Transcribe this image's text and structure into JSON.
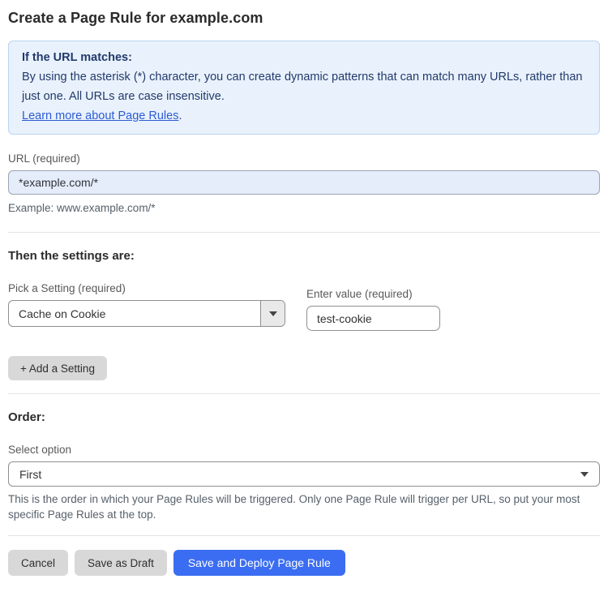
{
  "page": {
    "title": "Create a Page Rule for example.com"
  },
  "info_box": {
    "heading": "If the URL matches:",
    "body": "By using the asterisk (*) character, you can create dynamic patterns that can match many URLs, rather than just one. All URLs are case insensitive.",
    "link_label": "Learn more about Page Rules",
    "link_suffix": "."
  },
  "url_field": {
    "label": "URL (required)",
    "value": "*example.com/*",
    "example": "Example: www.example.com/*"
  },
  "settings_section": {
    "heading": "Then the settings are:",
    "setting_select": {
      "label": "Pick a Setting (required)",
      "value": "Cache on Cookie"
    },
    "value_field": {
      "label": "Enter value (required)",
      "value": "test-cookie"
    },
    "add_button_label": "+ Add a Setting"
  },
  "order_section": {
    "heading": "Order:",
    "select_label": "Select option",
    "select_value": "First",
    "help_text": "This is the order in which your Page Rules will be triggered. Only one Page Rule will trigger per URL, so put your most specific Page Rules at the top."
  },
  "footer": {
    "cancel_label": "Cancel",
    "save_draft_label": "Save as Draft",
    "save_deploy_label": "Save and Deploy Page Rule"
  },
  "colors": {
    "accent_blue": "#3b6df2",
    "info_background": "#e9f2fc",
    "info_border": "#b9d4f1",
    "info_text": "#22396b",
    "link_blue": "#2c5bd4",
    "url_input_background": "#e5ecfa"
  },
  "icons": {
    "dropdown_arrow": "triangle-down"
  }
}
